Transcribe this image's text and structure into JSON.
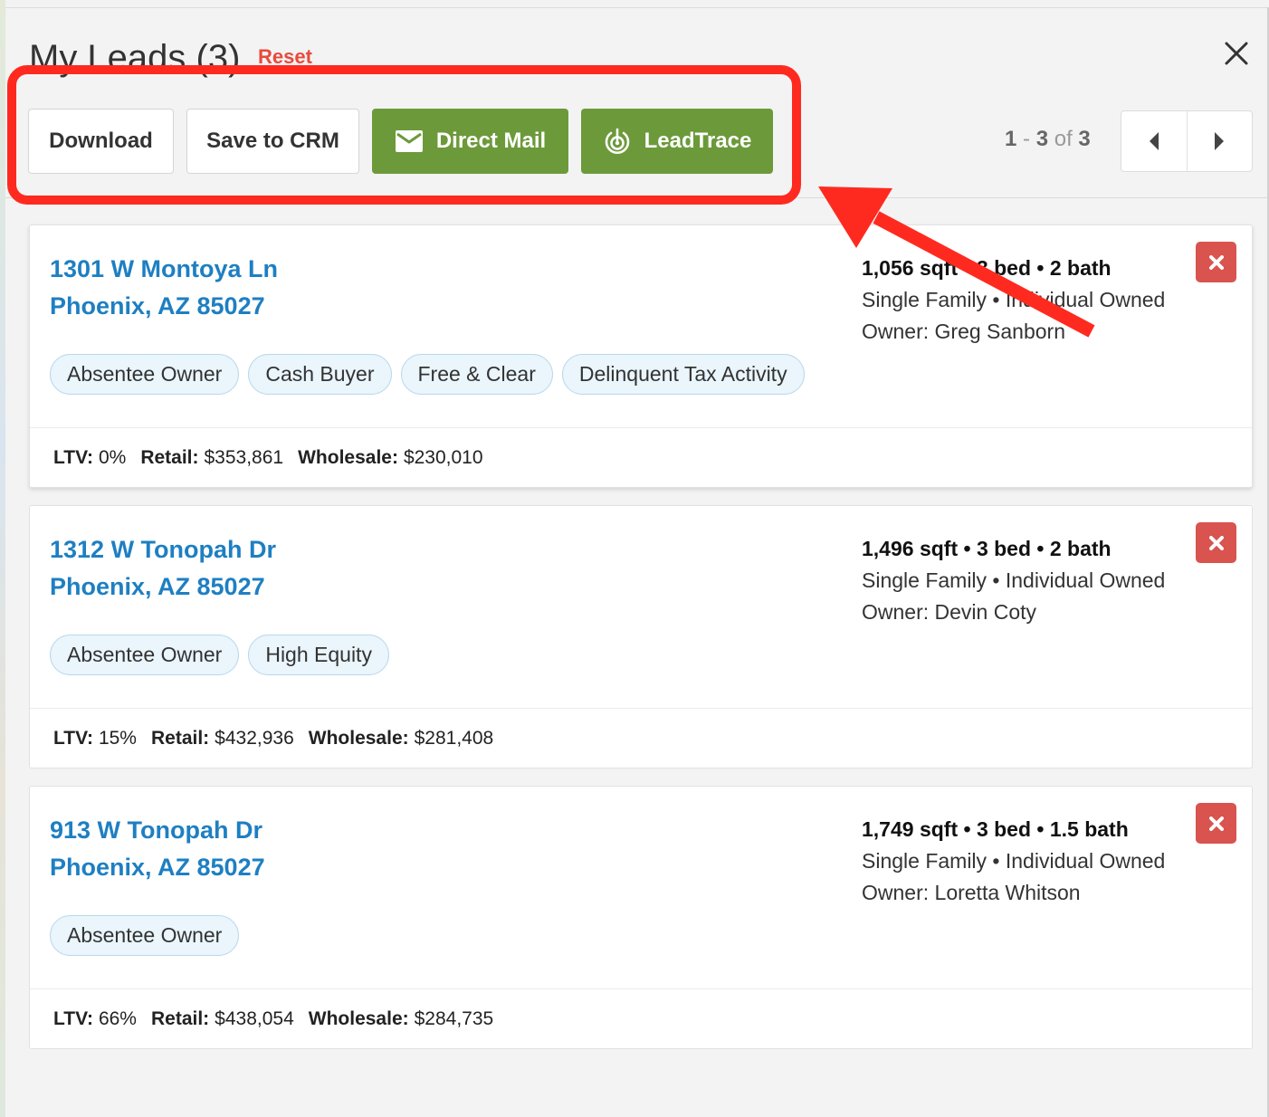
{
  "panel": {
    "title": "My Leads (3)",
    "reset_label": "Reset"
  },
  "toolbar": {
    "download_label": "Download",
    "save_crm_label": "Save to CRM",
    "direct_mail_label": "Direct Mail",
    "leadtrace_label": "LeadTrace",
    "direct_mail_icon": "envelope-icon",
    "leadtrace_icon": "target-icon"
  },
  "pagination": {
    "start": "1",
    "sep": " - ",
    "end": "3",
    "of_label": " of ",
    "total": "3"
  },
  "leads": [
    {
      "street": "1301 W Montoya Ln",
      "city": "Phoenix, AZ 85027",
      "tags": [
        "Absentee Owner",
        "Cash Buyer",
        "Free & Clear",
        "Delinquent Tax Activity"
      ],
      "specs": "1,056 sqft • 3 bed • 2 bath",
      "type": "Single Family • Individual Owned",
      "owner": "Owner: Greg Sanborn",
      "ltv_label": "LTV:",
      "ltv": "0%",
      "retail_label": "Retail:",
      "retail": "$353,861",
      "wholesale_label": "Wholesale:",
      "wholesale": "$230,010"
    },
    {
      "street": "1312 W Tonopah Dr",
      "city": "Phoenix, AZ 85027",
      "tags": [
        "Absentee Owner",
        "High Equity"
      ],
      "specs": "1,496 sqft • 3 bed • 2 bath",
      "type": "Single Family • Individual Owned",
      "owner": "Owner: Devin Coty",
      "ltv_label": "LTV:",
      "ltv": "15%",
      "retail_label": "Retail:",
      "retail": "$432,936",
      "wholesale_label": "Wholesale:",
      "wholesale": "$281,408"
    },
    {
      "street": "913 W Tonopah Dr",
      "city": "Phoenix, AZ 85027",
      "tags": [
        "Absentee Owner"
      ],
      "specs": "1,749 sqft • 3 bed • 1.5 bath",
      "type": "Single Family • Individual Owned",
      "owner": "Owner: Loretta Whitson",
      "ltv_label": "LTV:",
      "ltv": "66%",
      "retail_label": "Retail:",
      "retail": "$438,054",
      "wholesale_label": "Wholesale:",
      "wholesale": "$284,735"
    }
  ],
  "colors": {
    "accent_green": "#6c9a3a",
    "link_blue": "#1e7fc2",
    "remove_red": "#d9534f",
    "annotation_red": "#ff2a1f",
    "reset_red": "#e84b3c"
  }
}
